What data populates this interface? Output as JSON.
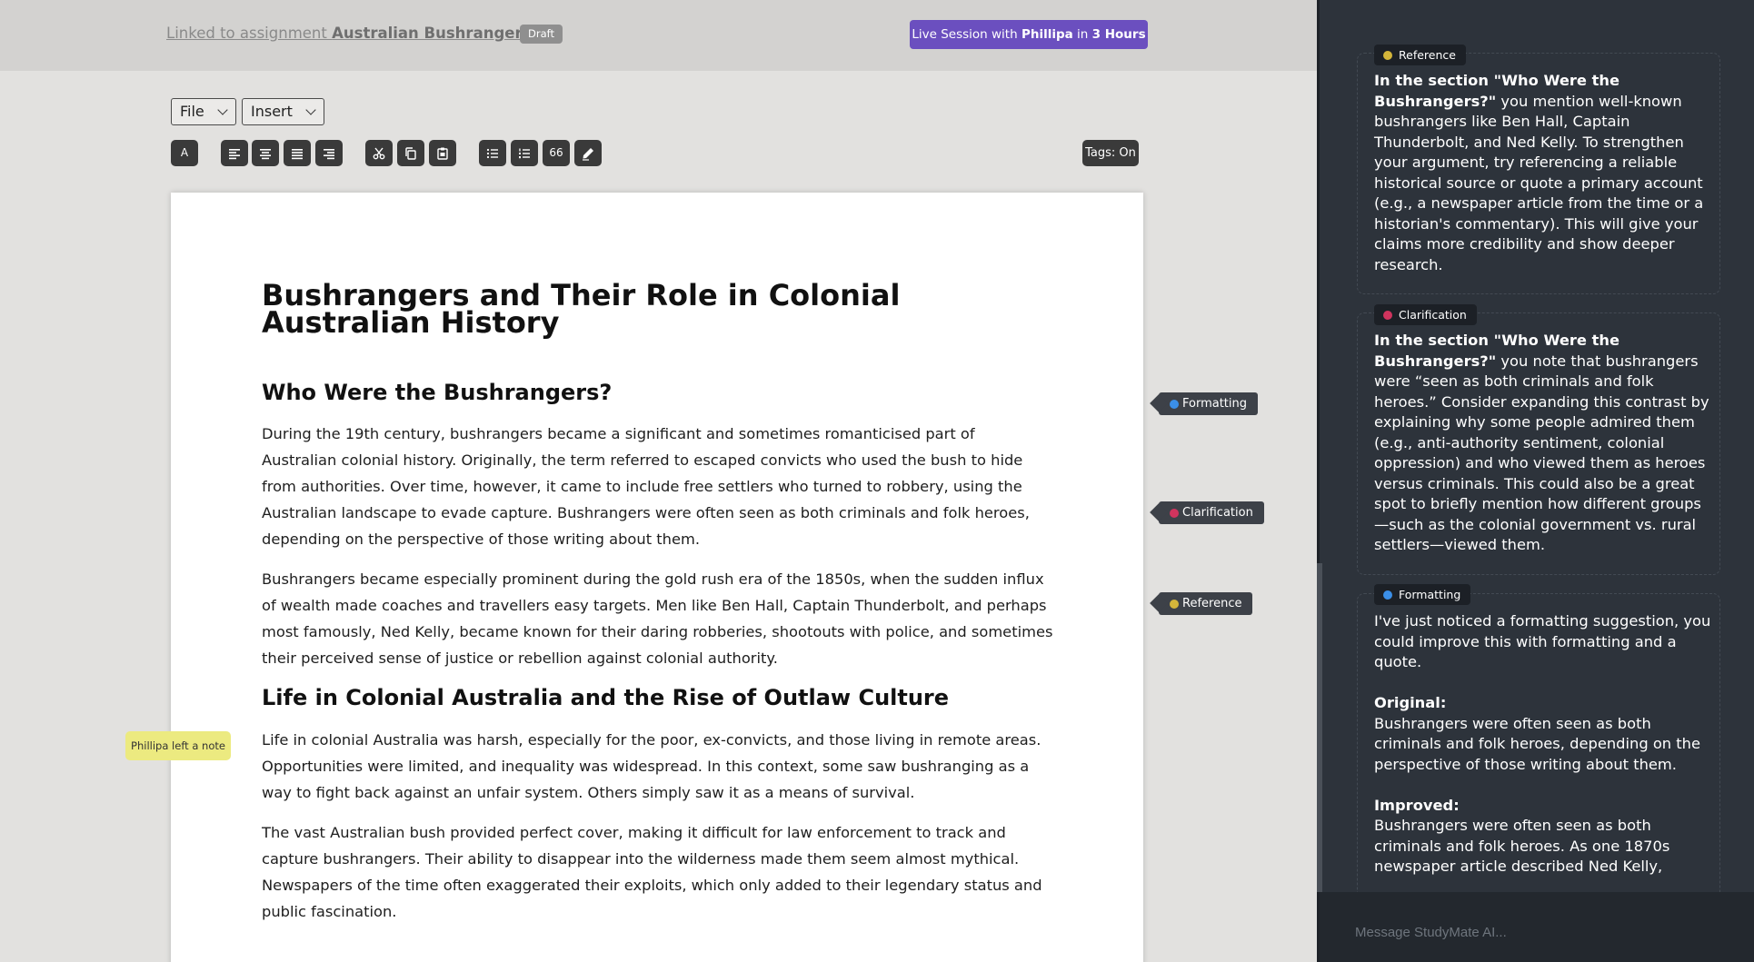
{
  "topbar": {
    "link_prefix": "Linked to assignment ",
    "link_name": "Australian Bushrangers",
    "draft_label": "Draft",
    "live_prefix": "Live Session with ",
    "live_name": "Phillipa",
    "live_mid": " in ",
    "live_time": "3 Hours"
  },
  "menus": {
    "file": "File",
    "insert": "Insert"
  },
  "toolbar": {
    "font_label": "A",
    "quote_label": "66",
    "tags_label": "Tags: On"
  },
  "document": {
    "title": "Bushrangers and Their Role in Colonial Australian History",
    "h_who": "Who Were the Bushrangers?",
    "p1": "During the 19th century, bushrangers became a significant and sometimes romanticised part of Australian colonial history. Originally, the term referred to escaped convicts who used the bush to hide from authorities. Over time, however, it came to include free settlers who turned to robbery, using the Australian landscape to evade capture. Bushrangers were often seen as both criminals and folk heroes, depending on the perspective of those writing about them.",
    "p2": "Bushrangers became especially prominent during the gold rush era of the 1850s, when the sudden influx of wealth made coaches and travellers easy targets. Men like Ben Hall, Captain Thunderbolt, and perhaps most famously, Ned Kelly, became known for their daring robberies, shootouts with police, and sometimes their perceived sense of justice or rebellion against colonial authority.",
    "h_life": "Life in Colonial Australia and the Rise of Outlaw Culture",
    "p3": "Life in colonial Australia was harsh, especially for the poor, ex-convicts, and those living in remote areas. Opportunities were limited, and inequality was widespread. In this context, some saw bushranging as a way to fight back against an unfair system. Others simply saw it as a means of survival.",
    "p4": "The vast Australian bush provided perfect cover, making it difficult for law enforcement to track and capture bushrangers. Their ability to disappear into the wilderness made them seem almost mythical. Newspapers of the time often exaggerated their exploits, which only added to their legendary status and public fascination."
  },
  "flags": {
    "formatting": "Formatting",
    "clarification": "Clarification",
    "reference": "Reference"
  },
  "note": "Phillipa left a note",
  "colors": {
    "formatting": "#3b8fe8",
    "clarification": "#d0345e",
    "reference": "#d4b53a",
    "live_session": "#6b4fbf"
  },
  "panel": {
    "reference": {
      "label": "Reference",
      "bold": "In the section \"Who Were the Bushrangers?\"",
      "text": " you mention well-known bushrangers like Ben Hall, Captain Thunderbolt, and Ned Kelly. To strengthen your argument, try referencing a reliable historical source or quote a primary account (e.g., a newspaper article from the time or a historian's commentary). This will give your claims more credibility and show deeper research."
    },
    "clarification": {
      "label": "Clarification",
      "bold": "In the section \"Who Were the Bushrangers?\"",
      "text": " you note that bushrangers were “seen as both criminals and folk heroes.” Consider expanding this contrast by explaining why some people admired them (e.g., anti-authority sentiment, colonial oppression) and who viewed them as heroes versus criminals. This could also be a great spot to briefly mention how different groups—such as the colonial government vs. rural settlers—viewed them."
    },
    "formatting": {
      "label": "Formatting",
      "intro": "I've just noticed a formatting suggestion, you could improve this with formatting and a quote.",
      "original_label": "Original:",
      "original_text": "Bushrangers were often seen as both criminals and folk heroes, depending on the perspective of those writing about them.",
      "improved_label": "Improved:",
      "improved_text": "Bushrangers were often seen as both criminals and folk heroes. As one 1870s newspaper article described Ned Kelly,"
    },
    "message_placeholder": "Message StudyMate AI..."
  }
}
